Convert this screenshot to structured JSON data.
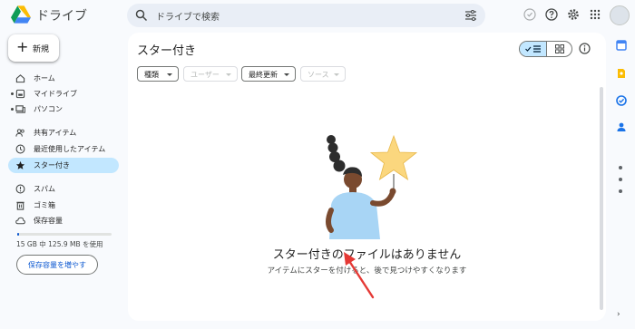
{
  "header": {
    "app_title": "ドライブ",
    "search_placeholder": "ドライブで検索"
  },
  "sidebar": {
    "new_label": "新規",
    "items": [
      {
        "label": "ホーム",
        "icon": "home-icon"
      },
      {
        "label": "マイドライブ",
        "icon": "my-drive-icon"
      },
      {
        "label": "パソコン",
        "icon": "computer-icon"
      },
      {
        "label": "共有アイテム",
        "icon": "shared-icon"
      },
      {
        "label": "最近使用したアイテム",
        "icon": "clock-icon"
      },
      {
        "label": "スター付き",
        "icon": "star-icon",
        "active": true
      },
      {
        "label": "スパム",
        "icon": "spam-icon"
      },
      {
        "label": "ゴミ箱",
        "icon": "trash-icon"
      },
      {
        "label": "保存容量",
        "icon": "cloud-icon"
      }
    ],
    "storage_text": "15 GB 中 125.9 MB を使用",
    "storage_fraction": 0.008,
    "storage_button": "保存容量を増やす"
  },
  "main": {
    "title": "スター付き",
    "filters": [
      {
        "label": "種類",
        "enabled": true
      },
      {
        "label": "ユーザー",
        "enabled": false
      },
      {
        "label": "最終更新",
        "enabled": true
      },
      {
        "label": "ソース",
        "enabled": false
      }
    ],
    "empty_title": "スター付きのファイルはありません",
    "empty_subtitle": "アイテムにスターを付けると、後で見つけやすくなります"
  },
  "colors": {
    "accent": "#0b57d0",
    "active_bg": "#c2e7ff",
    "annotation_arrow": "#e53935"
  }
}
